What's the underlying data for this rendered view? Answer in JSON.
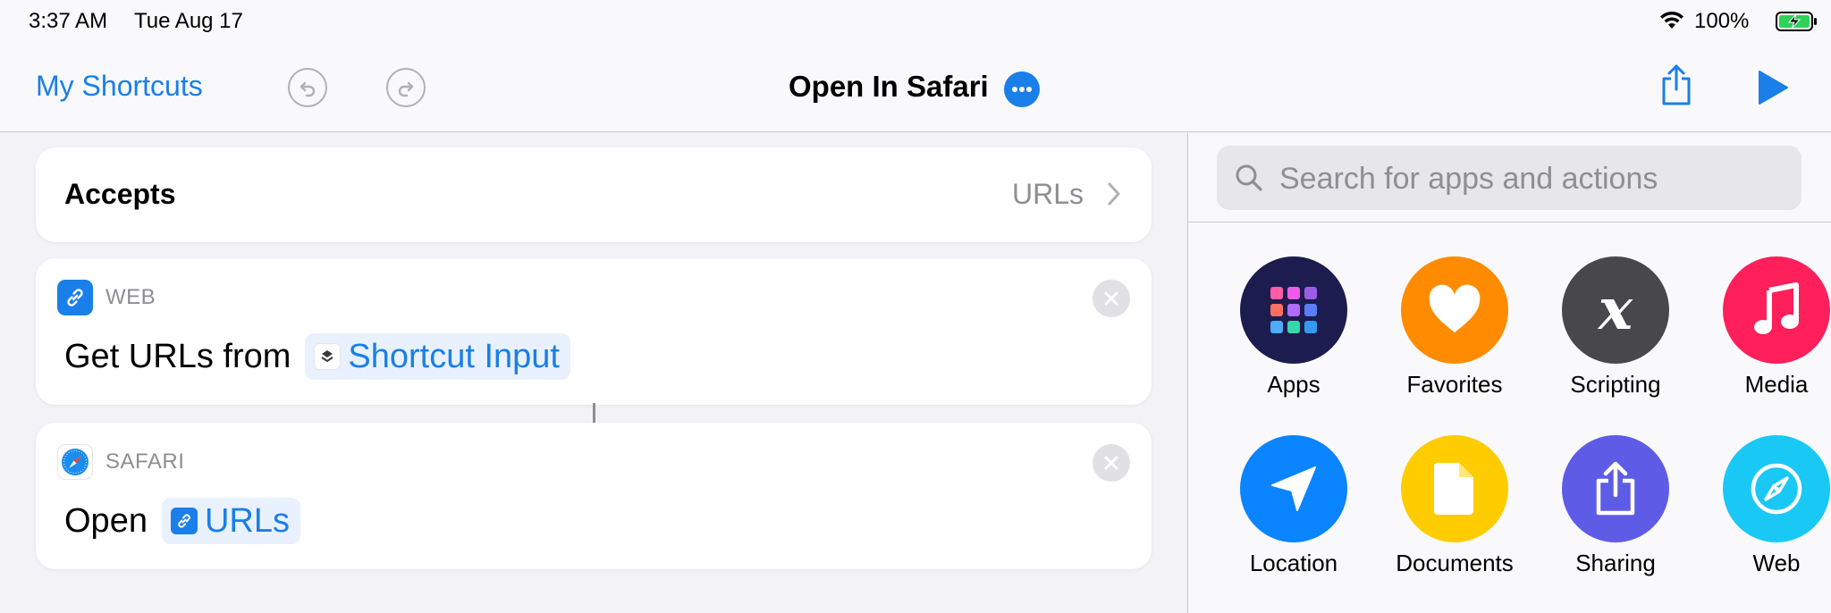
{
  "status": {
    "time": "3:37 AM",
    "date": "Tue Aug 17",
    "battery": "100%"
  },
  "nav": {
    "back_label": "My Shortcuts",
    "title": "Open In Safari"
  },
  "accepts": {
    "label": "Accepts",
    "value": "URLs"
  },
  "actions": [
    {
      "category": "WEB",
      "text": "Get URLs from",
      "token": "Shortcut Input"
    },
    {
      "category": "SAFARI",
      "text": "Open",
      "token": "URLs"
    }
  ],
  "search": {
    "placeholder": "Search for apps and actions"
  },
  "categories": [
    {
      "label": "Apps",
      "color": "#1c1c4e",
      "icon": "apps-grid-icon"
    },
    {
      "label": "Favorites",
      "color": "#ff8c00",
      "icon": "heart-icon"
    },
    {
      "label": "Scripting",
      "color": "#48484a",
      "icon": "variable-x-icon"
    },
    {
      "label": "Media",
      "color": "#ff1f5a",
      "icon": "music-note-icon"
    },
    {
      "label": "Location",
      "color": "#0a84ff",
      "icon": "location-arrow-icon"
    },
    {
      "label": "Documents",
      "color": "#ffcc00",
      "icon": "document-icon"
    },
    {
      "label": "Sharing",
      "color": "#5e5ce6",
      "icon": "share-icon"
    },
    {
      "label": "Web",
      "color": "#1ac8f5",
      "icon": "compass-icon"
    }
  ],
  "colors": {
    "accent": "#1a7fe8",
    "battery_green": "#30d158"
  }
}
